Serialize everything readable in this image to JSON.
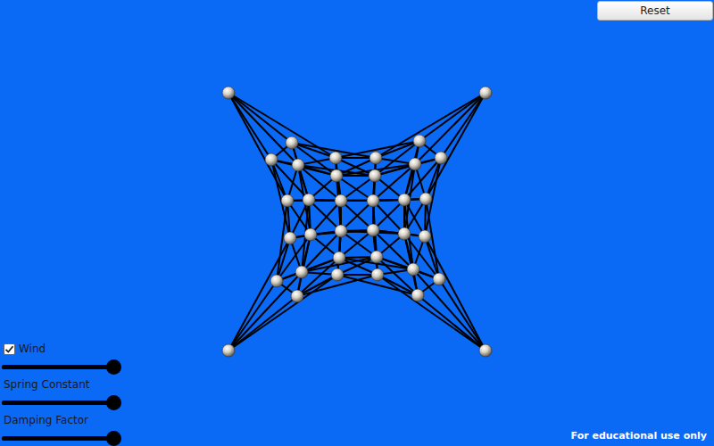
{
  "reset_button": {
    "label": "Reset"
  },
  "controls": [
    {
      "kind": "toggle-slider",
      "label": "Wind",
      "checked": true,
      "level": 1.0
    },
    {
      "kind": "slider",
      "label": "Spring Constant",
      "level": 1.0
    },
    {
      "kind": "slider",
      "label": "Damping Factor",
      "level": 1.0
    }
  ],
  "watermark": "For educational use only"
}
